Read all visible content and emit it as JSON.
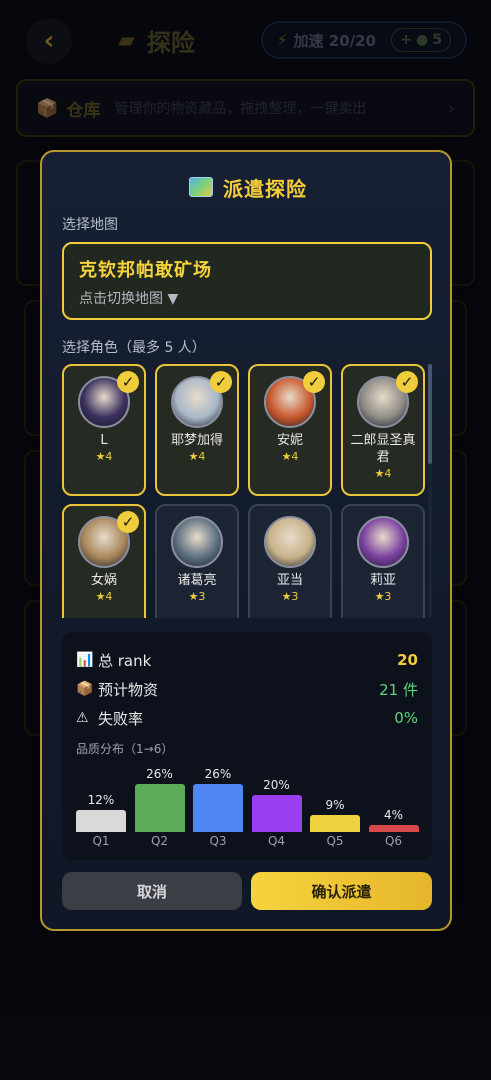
{
  "header": {
    "back_icon": "‹",
    "title": "探险",
    "speed_label": "加速 20/20",
    "speed_plus": "+",
    "speed_plus_count": "5"
  },
  "warehouse": {
    "title": "仓库",
    "desc": "管理你的物资藏品，拖拽整理，一键卖出",
    "chevron": "›"
  },
  "modal": {
    "title": "派遣探险",
    "map_label": "选择地图",
    "map_name": "克钦邦帕敢矿场",
    "map_hint": "点击切换地图 ▼",
    "role_label": "选择角色（最多 5 人）",
    "heroes": [
      {
        "name": "L",
        "stars": "★4",
        "selected": true,
        "color": "#3a2f5c"
      },
      {
        "name": "耶梦加得",
        "stars": "★4",
        "selected": true,
        "color": "#a9b7c8"
      },
      {
        "name": "安妮",
        "stars": "★4",
        "selected": true,
        "color": "#c8582c"
      },
      {
        "name": "二郎显圣真君",
        "stars": "★4",
        "selected": true,
        "color": "#8f8b86"
      },
      {
        "name": "女娲",
        "stars": "★4",
        "selected": true,
        "color": "#a7865a"
      },
      {
        "name": "诸葛亮",
        "stars": "★3",
        "selected": false,
        "color": "#5c6e80"
      },
      {
        "name": "亚当",
        "stars": "★3",
        "selected": false,
        "color": "#c8b28a"
      },
      {
        "name": "莉亚",
        "stars": "★3",
        "selected": false,
        "color": "#7a3fa0"
      }
    ],
    "check_mark": "✓",
    "stats": {
      "rank_label": "总 rank",
      "rank_value": "20",
      "items_label": "预计物资",
      "items_value": "21 件",
      "fail_label": "失败率",
      "fail_value": "0%",
      "dist_label": "品质分布（1→6）",
      "icons": {
        "rank": "📊",
        "items": "📦",
        "fail": "⚠"
      }
    },
    "cancel": "取消",
    "confirm": "确认派遣"
  },
  "chart_data": {
    "type": "bar",
    "categories": [
      "Q1",
      "Q2",
      "Q3",
      "Q4",
      "Q5",
      "Q6"
    ],
    "values": [
      12,
      26,
      26,
      20,
      9,
      4
    ],
    "labels": [
      "12%",
      "26%",
      "26%",
      "20%",
      "9%",
      "4%"
    ],
    "colors": [
      "#d9d9d9",
      "#5cad5a",
      "#4f86f4",
      "#9a3ff0",
      "#f0d23e",
      "#d94a4a"
    ]
  },
  "colors": {
    "accent": "#f0cd3c",
    "items_value": "#5fd37a",
    "fail_value": "#5fd37a"
  }
}
